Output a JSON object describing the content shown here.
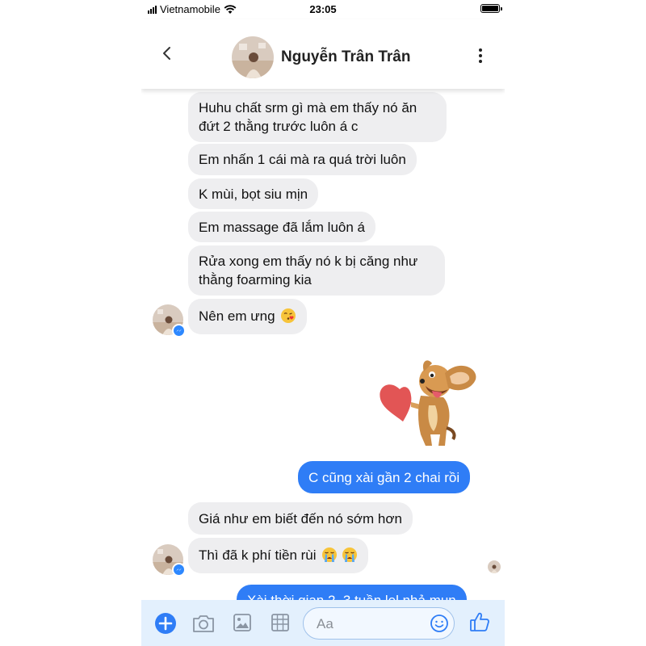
{
  "status": {
    "carrier": "Vietnamobile",
    "time": "23:05"
  },
  "header": {
    "contact_name": "Nguyễn Trân Trân"
  },
  "messages": [
    {
      "from": "contact",
      "lines": [
        "Huhu chất srm gì mà em thấy nó ăn",
        "đứt 2 thằng trước luôn á c"
      ]
    },
    {
      "from": "contact",
      "text": "Em nhấn 1 cái mà ra quá trời luôn"
    },
    {
      "from": "contact",
      "text": "K mùi, bọt siu mịn"
    },
    {
      "from": "contact",
      "text": "Em massage đã lắm luôn á"
    },
    {
      "from": "contact",
      "lines": [
        "Rửa xong em thấy nó k bị căng như",
        "thằng foarming kia"
      ]
    },
    {
      "from": "contact",
      "text": "Nên em ưng",
      "emoji": "kissing-heart-emoji"
    },
    {
      "from": "me",
      "type": "sticker",
      "sticker": "dog-with-heart-sticker"
    },
    {
      "from": "me",
      "text": "C cũng xài gần 2 chai rồi"
    },
    {
      "from": "contact",
      "text": "Giá như em biết đến nó sớm hơn"
    },
    {
      "from": "contact",
      "text": "Thì đã k phí tiền rùi",
      "emoji": "crying-emoji x2"
    },
    {
      "from": "me",
      "text": "Xài thời gian 2, 3 tuần lel nhả mụn"
    }
  ],
  "composer": {
    "placeholder": "Aa",
    "icons": [
      "plus-icon",
      "camera-icon",
      "photo-icon",
      "sticker-grid-icon",
      "smiley-icon",
      "thumbs-up-icon"
    ]
  },
  "colors": {
    "accent": "#2f7df6",
    "incoming_bubble": "#eeeef0",
    "composer_bg": "#e3f0fd"
  }
}
